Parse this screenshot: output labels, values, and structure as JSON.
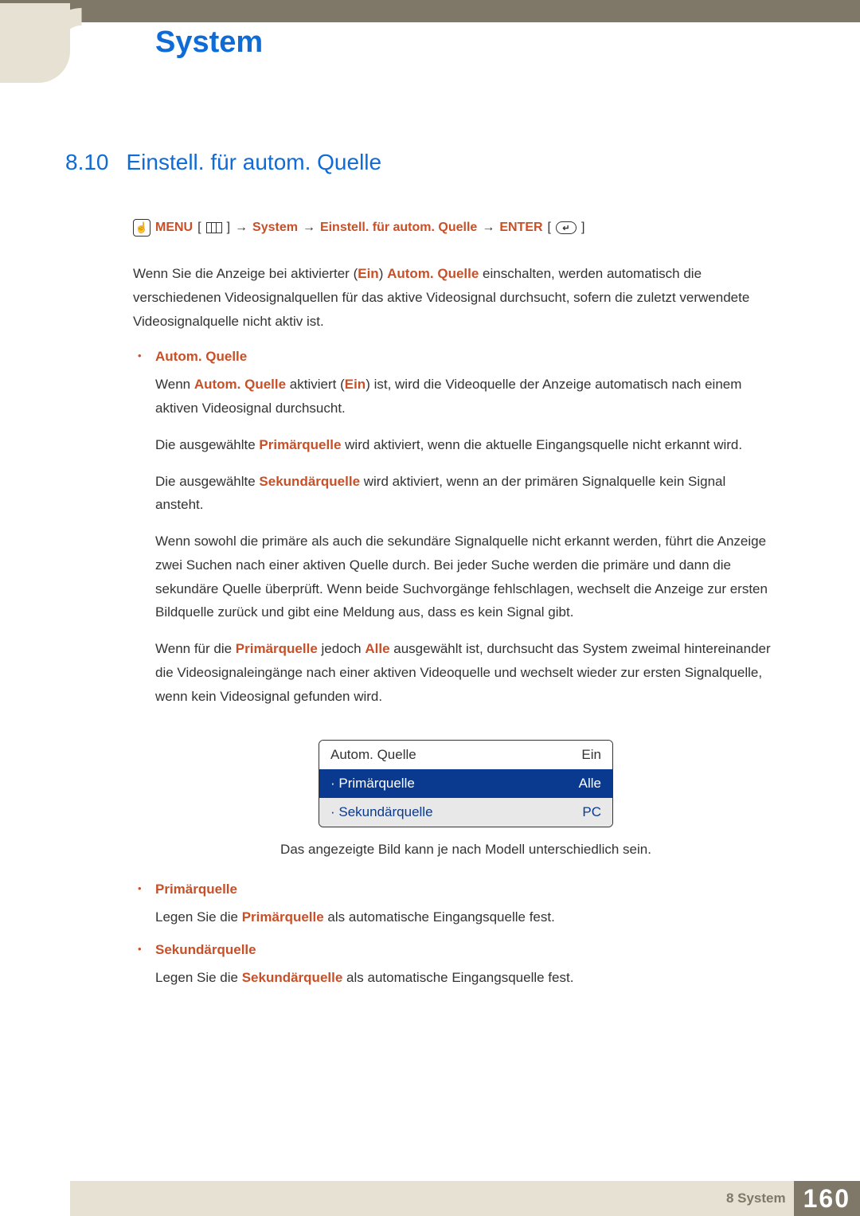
{
  "header": {
    "chapter_title": "System"
  },
  "section": {
    "number": "8.10",
    "title": "Einstell. für autom. Quelle"
  },
  "nav_path": {
    "menu_label": "MENU",
    "step1": "System",
    "step2": "Einstell. für autom. Quelle",
    "enter_label": "ENTER"
  },
  "intro": {
    "t1": "Wenn Sie die Anzeige bei aktivierter (",
    "ein": "Ein",
    "t2": ") ",
    "autom_quelle": "Autom. Quelle",
    "t3": " einschalten, werden automatisch die verschiedenen Videosignalquellen für das aktive Videosignal durchsucht, sofern die zuletzt verwendete Videosignalquelle nicht aktiv ist."
  },
  "bullet_autom": {
    "title": "Autom. Quelle",
    "p1a": "Wenn ",
    "p1b": "Autom. Quelle",
    "p1c": " aktiviert (",
    "p1d": "Ein",
    "p1e": ") ist, wird die Videoquelle der Anzeige automatisch nach einem aktiven Videosignal durchsucht.",
    "p2a": "Die ausgewählte ",
    "p2b": "Primärquelle",
    "p2c": " wird aktiviert, wenn die aktuelle Eingangsquelle nicht erkannt wird.",
    "p3a": "Die ausgewählte ",
    "p3b": "Sekundärquelle",
    "p3c": " wird aktiviert, wenn an der primären Signalquelle kein Signal ansteht.",
    "p4": "Wenn sowohl die primäre als auch die sekundäre Signalquelle nicht erkannt werden, führt die Anzeige zwei Suchen nach einer aktiven Quelle durch. Bei jeder Suche werden die primäre und dann die sekundäre Quelle überprüft. Wenn beide Suchvorgänge fehlschlagen, wechselt die Anzeige zur ersten Bildquelle zurück und gibt eine Meldung aus, dass es kein Signal gibt.",
    "p5a": "Wenn für die ",
    "p5b": "Primärquelle",
    "p5c": " jedoch ",
    "p5d": "Alle",
    "p5e": " ausgewählt ist, durchsucht das System zweimal hintereinander die Videosignaleingänge nach einer aktiven Videoquelle und wechselt wieder zur ersten Signalquelle, wenn kein Videosignal gefunden wird."
  },
  "menu_box": {
    "row1": {
      "label": "Autom. Quelle",
      "value": "Ein"
    },
    "row2": {
      "label": "· Primärquelle",
      "value": "Alle"
    },
    "row3": {
      "label": "· Sekundärquelle",
      "value": "PC"
    }
  },
  "caption": "Das angezeigte Bild kann je nach Modell unterschiedlich sein.",
  "bullet_primary": {
    "title": "Primärquelle",
    "t1": "Legen Sie die ",
    "t2": "Primärquelle",
    "t3": " als automatische Eingangsquelle fest."
  },
  "bullet_secondary": {
    "title": "Sekundärquelle",
    "t1": "Legen Sie die ",
    "t2": "Sekundärquelle",
    "t3": " als automatische Eingangsquelle fest."
  },
  "footer": {
    "chapter": "8 System",
    "page": "160"
  }
}
